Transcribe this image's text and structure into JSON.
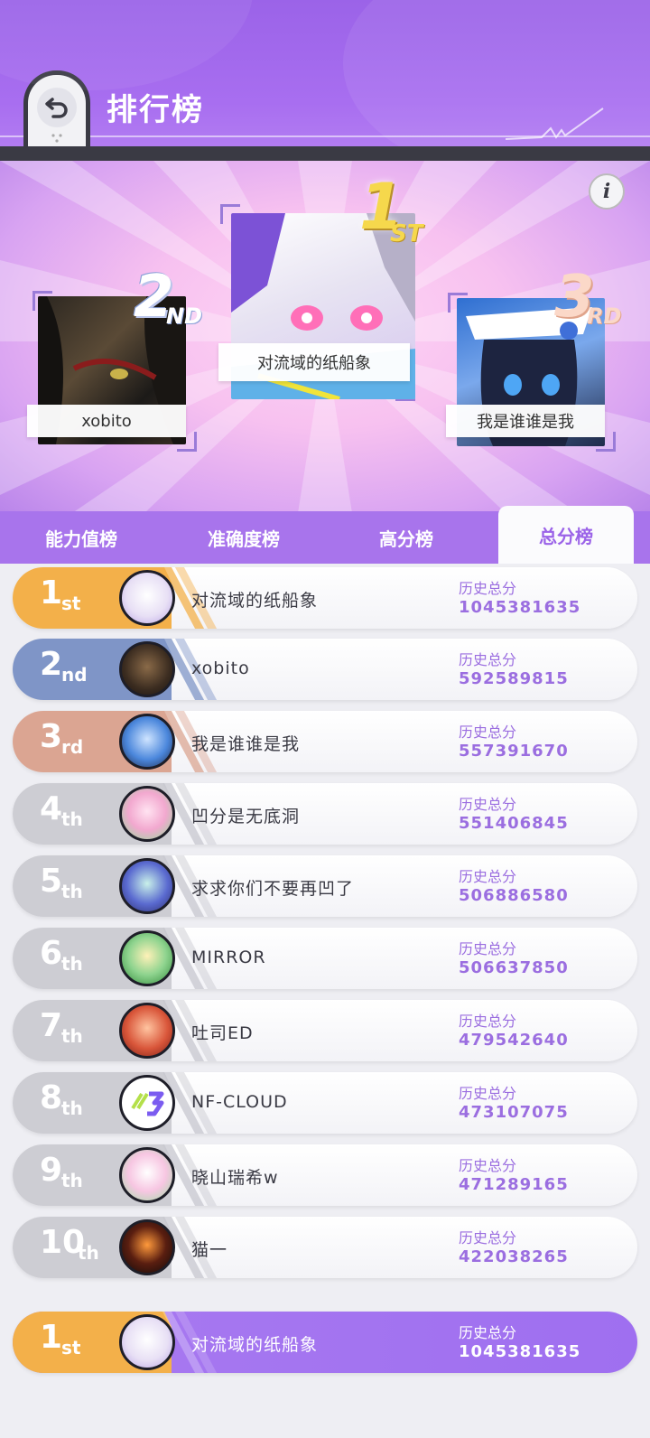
{
  "header": {
    "title": "排行榜",
    "back_icon": "back-arrow-icon"
  },
  "podium": {
    "info_label": "i",
    "first": {
      "name": "对流域的纸船象",
      "rank_num": "1",
      "rank_suffix": "ST"
    },
    "second": {
      "name": "xobito",
      "rank_num": "2",
      "rank_suffix": "ND"
    },
    "third": {
      "name": "我是谁谁是我",
      "rank_num": "3",
      "rank_suffix": "RD"
    }
  },
  "tabs": [
    {
      "label": "能力值榜"
    },
    {
      "label": "准确度榜"
    },
    {
      "label": "高分榜"
    },
    {
      "label": "总分榜"
    }
  ],
  "active_tab": "总分榜",
  "rows": [
    {
      "num": "1",
      "suffix": "st",
      "name": "对流域的纸船象",
      "score_label": "历史总分",
      "score": "1045381635"
    },
    {
      "num": "2",
      "suffix": "nd",
      "name": "xobito",
      "score_label": "历史总分",
      "score": "592589815"
    },
    {
      "num": "3",
      "suffix": "rd",
      "name": "我是谁谁是我",
      "score_label": "历史总分",
      "score": "557391670"
    },
    {
      "num": "4",
      "suffix": "th",
      "name": "凹分是无底洞",
      "score_label": "历史总分",
      "score": "551406845"
    },
    {
      "num": "5",
      "suffix": "th",
      "name": "求求你们不要再凹了",
      "score_label": "历史总分",
      "score": "506886580"
    },
    {
      "num": "6",
      "suffix": "th",
      "name": "MIRROR",
      "score_label": "历史总分",
      "score": "506637850"
    },
    {
      "num": "7",
      "suffix": "th",
      "name": "吐司ED",
      "score_label": "历史总分",
      "score": "479542640"
    },
    {
      "num": "8",
      "suffix": "th",
      "name": "NF-CLOUD",
      "score_label": "历史总分",
      "score": "473107075"
    },
    {
      "num": "9",
      "suffix": "th",
      "name": "晓山瑞希w",
      "score_label": "历史总分",
      "score": "471289165"
    },
    {
      "num": "10",
      "suffix": "th",
      "name": "猫一",
      "score_label": "历史总分",
      "score": "422038265"
    }
  ],
  "my_row": {
    "num": "1",
    "suffix": "st",
    "name": "对流域的纸船象",
    "score_label": "历史总分",
    "score": "1045381635"
  },
  "colors": {
    "accent": "#9b63e8",
    "gold": "#f3b04a",
    "silver": "#7f95c7",
    "bronze": "#dba592",
    "gray": "#cdcdd3"
  }
}
